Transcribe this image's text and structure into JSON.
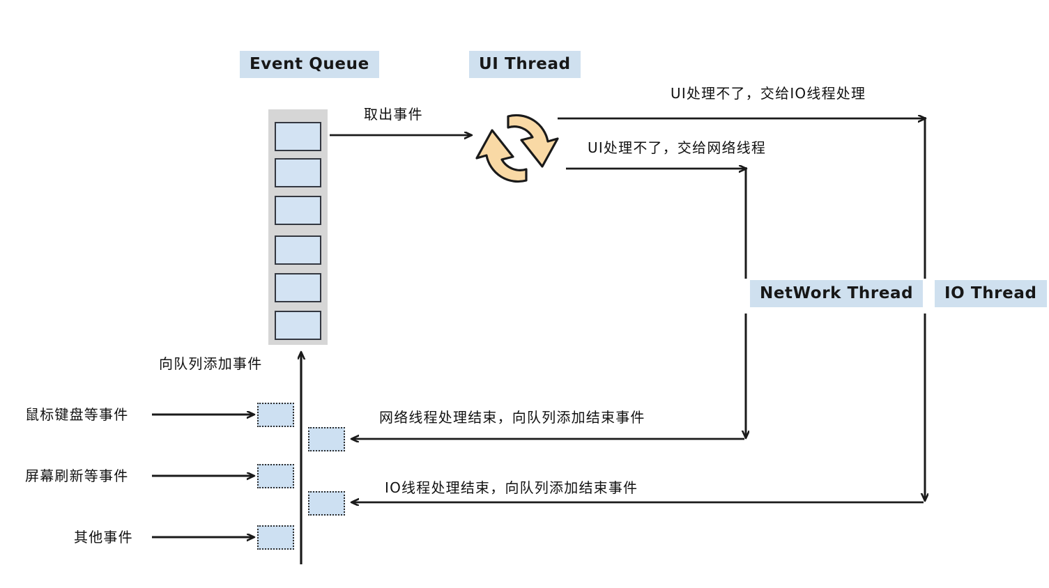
{
  "diagram": {
    "title_labels": [
      {
        "id": "event-queue",
        "text": "Event Queue"
      },
      {
        "id": "ui-thread",
        "text": "UI Thread"
      },
      {
        "id": "network-thread",
        "text": "NetWork Thread"
      },
      {
        "id": "io-thread",
        "text": "IO Thread"
      }
    ],
    "edge_labels": [
      {
        "id": "dequeue-event",
        "text": "取出事件"
      },
      {
        "id": "ui-to-io",
        "text": "UI处理不了，交给IO线程处理"
      },
      {
        "id": "ui-to-network",
        "text": "UI处理不了，交给网络线程"
      },
      {
        "id": "enqueue-event",
        "text": "向队列添加事件"
      },
      {
        "id": "network-done",
        "text": "网络线程处理结束，向队列添加结束事件"
      },
      {
        "id": "io-done",
        "text": "IO线程处理结束，向队列添加结束事件"
      }
    ],
    "source_events": [
      {
        "id": "mouse-keyboard",
        "text": "鼠标键盘等事件"
      },
      {
        "id": "screen-refresh",
        "text": "屏幕刷新等事件"
      },
      {
        "id": "other-events",
        "text": "其他事件"
      }
    ],
    "queue_slot_count": 6,
    "colors": {
      "label_background": "#cfe0ef",
      "queue_shell": "#d6d6d6",
      "queue_slot_fill": "#d3e3f3",
      "queue_slot_border": "#333740",
      "loop_icon_fill": "#f9d9a5",
      "loop_icon_stroke": "#1a1a1a",
      "stroke": "#1a1a1a",
      "dotted_box_fill": "#cde0f2",
      "background": "#ffffff"
    },
    "icons": {
      "loop": "circular-refresh-loop-icon"
    }
  }
}
